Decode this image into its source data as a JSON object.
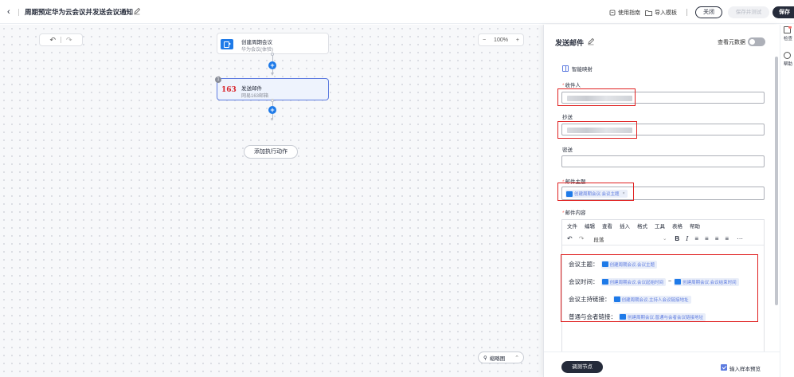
{
  "header": {
    "title": "周期预定华为云会议并发送会议通知",
    "usage_guide": "使用指南",
    "import_template": "导入模板",
    "close": "关闭",
    "save_and_test": "保存并测试",
    "save": "保存"
  },
  "canvas": {
    "zoom": "100%",
    "nodes": [
      {
        "title": "创建周期会议",
        "subtitle": "华为会议(体验)",
        "icon": "meeting-app-icon"
      },
      {
        "title": "发送邮件",
        "subtitle": "网易163邮箱",
        "icon": "163-mail-logo",
        "badge": "1"
      }
    ],
    "add_action": "添加执行动作",
    "minimap": "缩略图"
  },
  "panel": {
    "title": "发送邮件",
    "view_metadata": "查看元数据",
    "smart_fill": "智能映射",
    "fields": {
      "to": {
        "label": "收件人",
        "required": true
      },
      "cc": {
        "label": "抄送",
        "required": false
      },
      "bcc": {
        "label": "密送",
        "required": false
      },
      "subject": {
        "label": "邮件主题",
        "required": true,
        "tag": "创建周期会议.会议主题"
      },
      "content": {
        "label": "邮件内容",
        "required": true
      }
    },
    "editor": {
      "menu": [
        "文件",
        "编辑",
        "查看",
        "插入",
        "格式",
        "工具",
        "表格",
        "帮助"
      ],
      "paragraph": "段落",
      "lines": [
        {
          "label": "会议主题：",
          "tags": [
            "创建周期会议.会议主题"
          ]
        },
        {
          "label": "会议时间：",
          "tags": [
            "创建周期会议.会议起始时间",
            "创建周期会议.会议结束时间"
          ],
          "separator": "~"
        },
        {
          "label": "会议主持链接：",
          "tags": [
            "创建周期会议.主持人会议链接地址"
          ]
        },
        {
          "label": "普通与会者链接：",
          "tags": [
            "创建周期会议.普通与会者会议链接地址"
          ]
        }
      ]
    },
    "footer": {
      "debug_node": "调测节点",
      "use_sample_preview": "输入样本预览",
      "use_sample_checked": true
    }
  },
  "rail": {
    "items": [
      "检查",
      "帮助"
    ]
  }
}
